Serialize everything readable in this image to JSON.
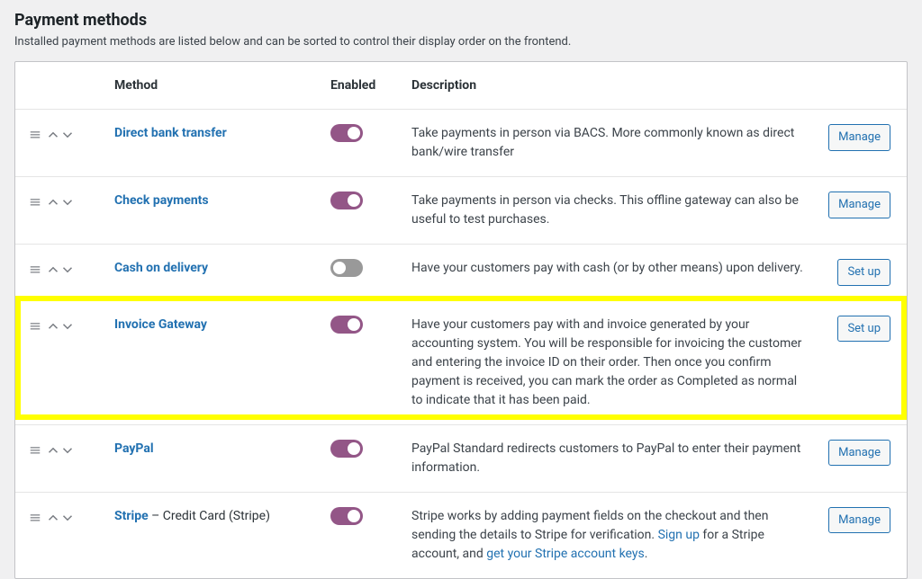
{
  "section": {
    "title": "Payment methods",
    "description": "Installed payment methods are listed below and can be sorted to control their display order on the frontend."
  },
  "columns": {
    "method": "Method",
    "enabled": "Enabled",
    "description": "Description"
  },
  "buttons": {
    "manage": "Manage",
    "setup": "Set up"
  },
  "methods": [
    {
      "name": "Direct bank transfer",
      "suffix": "",
      "enabled": true,
      "description_segments": [
        {
          "t": "Take payments in person via BACS. More commonly known as direct bank/wire transfer"
        }
      ],
      "action": "manage",
      "highlighted": false
    },
    {
      "name": "Check payments",
      "suffix": "",
      "enabled": true,
      "description_segments": [
        {
          "t": "Take payments in person via checks. This offline gateway can also be useful to test purchases."
        }
      ],
      "action": "manage",
      "highlighted": false
    },
    {
      "name": "Cash on delivery",
      "suffix": "",
      "enabled": false,
      "description_segments": [
        {
          "t": "Have your customers pay with cash (or by other means) upon delivery."
        }
      ],
      "action": "setup",
      "highlighted": false
    },
    {
      "name": "Invoice Gateway",
      "suffix": "",
      "enabled": true,
      "description_segments": [
        {
          "t": "Have your customers pay with and invoice generated by your accounting system. You will be responsible for invoicing the customer and entering the invoice ID on their order. Then once you confirm payment is received, you can mark the order as Completed as normal to indicate that it has been paid."
        }
      ],
      "action": "setup",
      "highlighted": true
    },
    {
      "name": "PayPal",
      "suffix": "",
      "enabled": true,
      "description_segments": [
        {
          "t": "PayPal Standard redirects customers to PayPal to enter their payment information."
        }
      ],
      "action": "manage",
      "highlighted": false
    },
    {
      "name": "Stripe",
      "suffix": " – Credit Card (Stripe)",
      "enabled": true,
      "description_segments": [
        {
          "t": "Stripe works by adding payment fields on the checkout and then sending the details to Stripe for verification. "
        },
        {
          "t": "Sign up",
          "link": true
        },
        {
          "t": " for a Stripe account, and "
        },
        {
          "t": "get your Stripe account keys",
          "link": true
        },
        {
          "t": "."
        }
      ],
      "action": "manage",
      "highlighted": false
    }
  ]
}
